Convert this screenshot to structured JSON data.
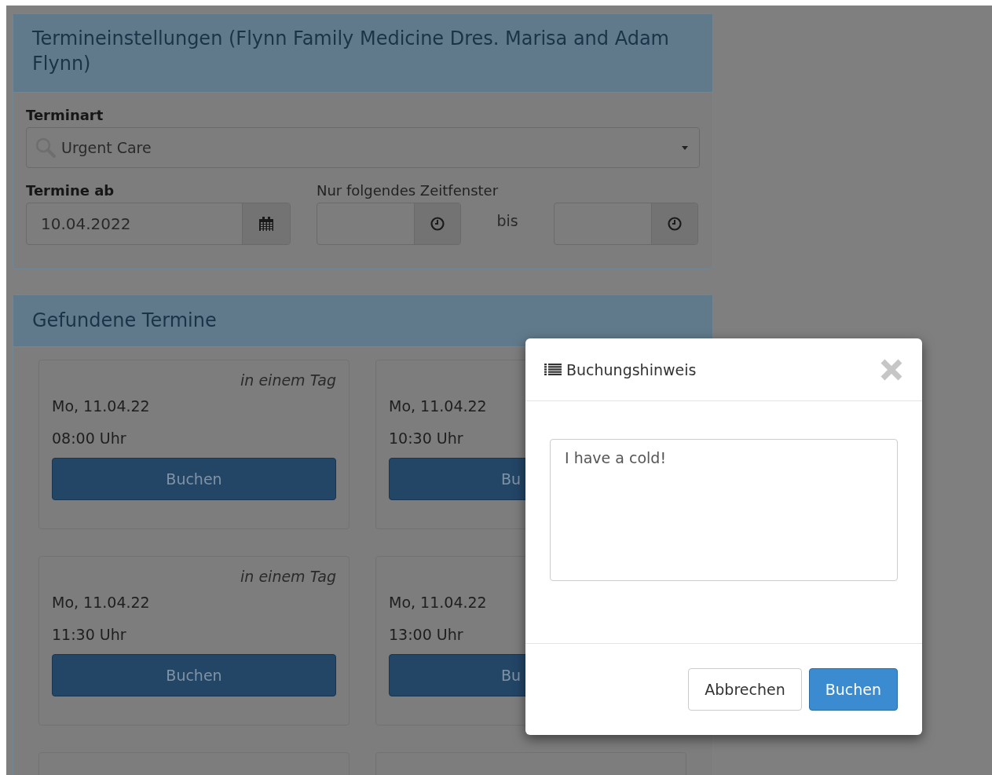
{
  "settings_panel": {
    "title": "Termineinstellungen (Flynn Family Medicine Dres. Marisa and Adam Flynn)",
    "type_field": {
      "label": "Terminart",
      "value": "Urgent Care"
    },
    "date_field": {
      "label": "Termine ab",
      "value": "10.04.2022"
    },
    "time_window": {
      "label": "Nur folgendes Zeitfenster",
      "separator": "bis"
    }
  },
  "results_panel": {
    "title": "Gefundene Termine",
    "slots": [
      {
        "tag": "in einem Tag",
        "date": "Mo, 11.04.22",
        "time": "08:00 Uhr",
        "button": "Buchen",
        "covered": false
      },
      {
        "date": "Mo, 11.04.22",
        "time": "10:30 Uhr",
        "button": "Bu",
        "covered": true
      },
      {
        "tag": "in einem Tag",
        "date": "Mo, 11.04.22",
        "time": "11:30 Uhr",
        "button": "Buchen",
        "covered": false
      },
      {
        "date": "Mo, 11.04.22",
        "time": "13:00 Uhr",
        "button": "Bu",
        "covered": true
      }
    ]
  },
  "modal": {
    "title": "Buchungshinweis",
    "note": "I have a cold!",
    "buttons": [
      {
        "label": "Abbrechen",
        "kind": "default"
      },
      {
        "label": "Buchen",
        "kind": "primary"
      }
    ]
  }
}
